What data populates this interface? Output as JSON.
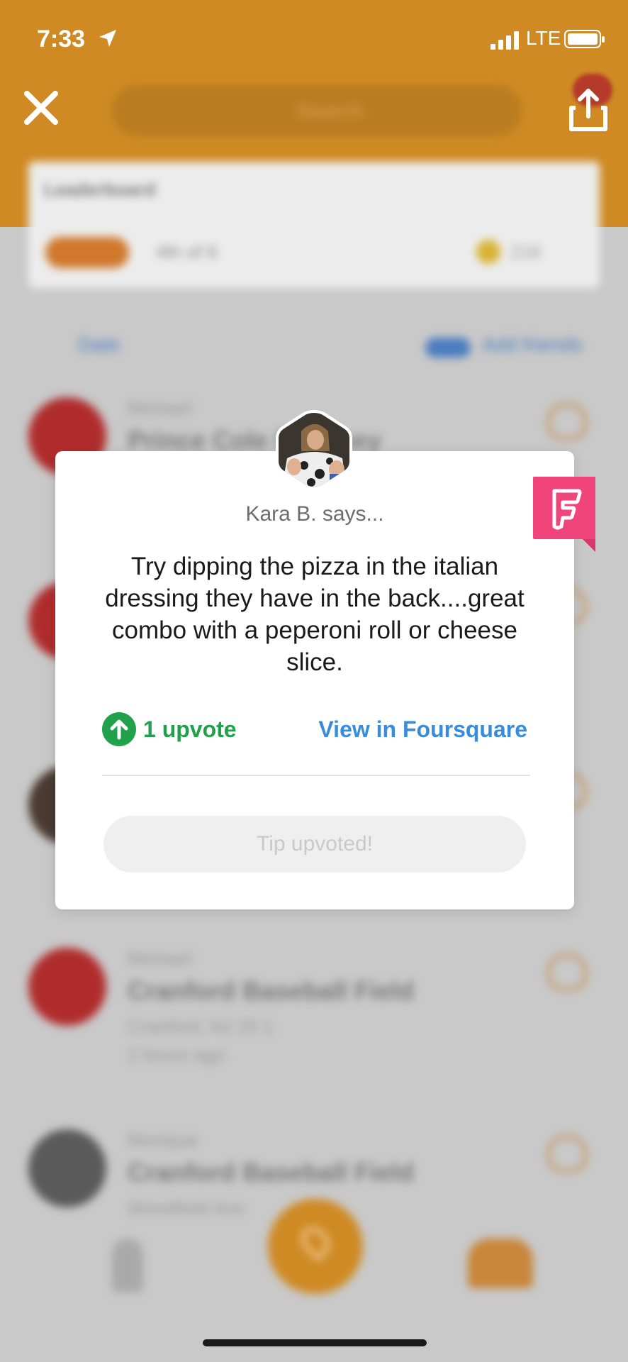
{
  "status_bar": {
    "time": "7:33",
    "network": "LTE"
  },
  "background": {
    "search_placeholder": "Search",
    "leaderboard": {
      "title": "Leaderboard",
      "rank": "4th of 6",
      "points": "216"
    },
    "filter": {
      "date_label": "Date",
      "add_friends": "Add friends"
    },
    "feed": [
      {
        "user": "Michael",
        "title": "Prince Cole Balloney",
        "meta": "",
        "time": ""
      },
      {
        "user": "Michael",
        "title": "Cranford Baseball Field",
        "meta": "Cranford, NJ  15  1",
        "time": "2 hours ago"
      },
      {
        "user": "Monique",
        "title": "Cranford Baseball Field",
        "meta": "Woodfield Ave",
        "time": ""
      }
    ]
  },
  "modal": {
    "author": "Kara B. says...",
    "tip": "Try dipping the pizza in the italian dressing they have in the back....great combo with a peperoni roll or cheese slice.",
    "upvotes": "1 upvote",
    "view_link": "View in Foursquare",
    "button_label": "Tip upvoted!"
  },
  "icons": {
    "close": "close-icon",
    "share": "share-icon",
    "foursquare": "foursquare-icon",
    "upvote": "upvote-arrow-icon",
    "location": "location-arrow-icon"
  },
  "colors": {
    "brand_orange": "#cf8a24",
    "foursquare_pink": "#f0457a",
    "upvote_green": "#22a14c",
    "link_blue": "#3a8bdc",
    "modal_bg": "#ffffff"
  }
}
